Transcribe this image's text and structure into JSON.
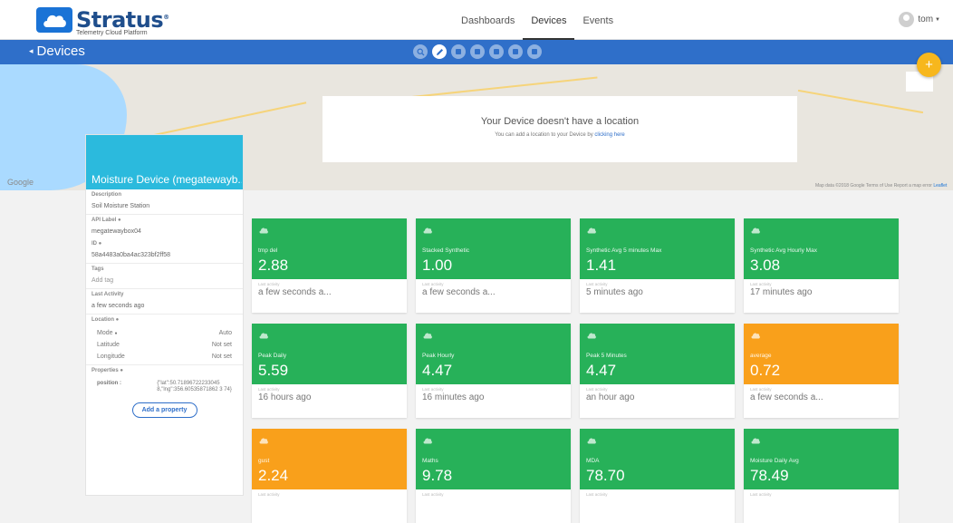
{
  "brand": {
    "name": "Stratus",
    "reg": "®",
    "tagline": "Telemetry Cloud Platform"
  },
  "nav": {
    "items": [
      {
        "label": "Dashboards"
      },
      {
        "label": "Devices"
      },
      {
        "label": "Events"
      }
    ],
    "active": "Devices"
  },
  "user": {
    "name": "tom"
  },
  "subbar": {
    "back_label": "Devices"
  },
  "map": {
    "provider": "Google",
    "no_location_title": "Your Device doesn't have a location",
    "no_location_text": "You can add a location to your Device by ",
    "no_location_link": "clicking here",
    "credit": "Map data ©2018 Google   Terms of Use   Report a map error ",
    "credit_link": "Leaflet"
  },
  "device": {
    "title": "Moisture Device (megatewayb...",
    "description_label": "Description",
    "description": "Soil Moisture Station",
    "api_label_label": "API Label",
    "api_label": "megatewaybox04",
    "id_label": "ID",
    "id": "58a4483a0ba4ac323bf2ff58",
    "tags_label": "Tags",
    "add_tag": "Add tag",
    "last_activity_label": "Last Activity",
    "last_activity": "a few seconds ago",
    "location_label": "Location",
    "mode_label": "Mode",
    "mode": "Auto",
    "latitude_label": "Latitude",
    "latitude": "Not set",
    "longitude_label": "Longitude",
    "longitude": "Not set",
    "properties_label": "Properties",
    "property_key": "position :",
    "property_value": "{\"lat\":50.71896722233045 8,\"lng\":356.60535871862 3 74}",
    "add_property": "Add a property"
  },
  "variables": [
    {
      "label": "tmp del",
      "value": "2.88",
      "last_activity_label": "Last activity",
      "last_activity": "a few seconds a...",
      "color": "green"
    },
    {
      "label": "Stacked Synthetic",
      "value": "1.00",
      "last_activity_label": "Last activity",
      "last_activity": "a few seconds a...",
      "color": "green"
    },
    {
      "label": "Synthetic Avg 5 minutes Max",
      "value": "1.41",
      "last_activity_label": "Last activity",
      "last_activity": "5 minutes ago",
      "color": "green"
    },
    {
      "label": "Synthetic Avg Hourly Max",
      "value": "3.08",
      "last_activity_label": "Last activity",
      "last_activity": "17 minutes ago",
      "color": "green"
    },
    {
      "label": "Peak Daily",
      "value": "5.59",
      "last_activity_label": "Last activity",
      "last_activity": "16 hours ago",
      "color": "green"
    },
    {
      "label": "Peak Hourly",
      "value": "4.47",
      "last_activity_label": "Last activity",
      "last_activity": "16 minutes ago",
      "color": "green"
    },
    {
      "label": "Peak 5 Minutes",
      "value": "4.47",
      "last_activity_label": "Last activity",
      "last_activity": "an hour ago",
      "color": "green"
    },
    {
      "label": "average",
      "value": "0.72",
      "last_activity_label": "Last activity",
      "last_activity": "a few seconds a...",
      "color": "orange"
    },
    {
      "label": "gust",
      "value": "2.24",
      "last_activity_label": "Last activity",
      "last_activity": "",
      "color": "orange"
    },
    {
      "label": "Maths",
      "value": "9.78",
      "last_activity_label": "Last activity",
      "last_activity": "",
      "color": "green"
    },
    {
      "label": "MDA",
      "value": "78.70",
      "last_activity_label": "Last activity",
      "last_activity": "",
      "color": "green"
    },
    {
      "label": "Moisture Daily Avg",
      "value": "78.49",
      "last_activity_label": "Last activity",
      "last_activity": "",
      "color": "green"
    }
  ],
  "colors": {
    "green": "#27b159",
    "orange": "#f9a01b",
    "blue": "#2f6fc9",
    "panel_header": "#2bbadd",
    "fab": "#f7b71d"
  },
  "icons": {
    "fab": "plus-icon",
    "card": "cloud-upload-icon",
    "toolbar": [
      "search-icon",
      "edit-icon",
      "delete-icon",
      "download-icon",
      "list-icon",
      "chart-icon",
      "upload-icon"
    ]
  },
  "fab_label": "+"
}
